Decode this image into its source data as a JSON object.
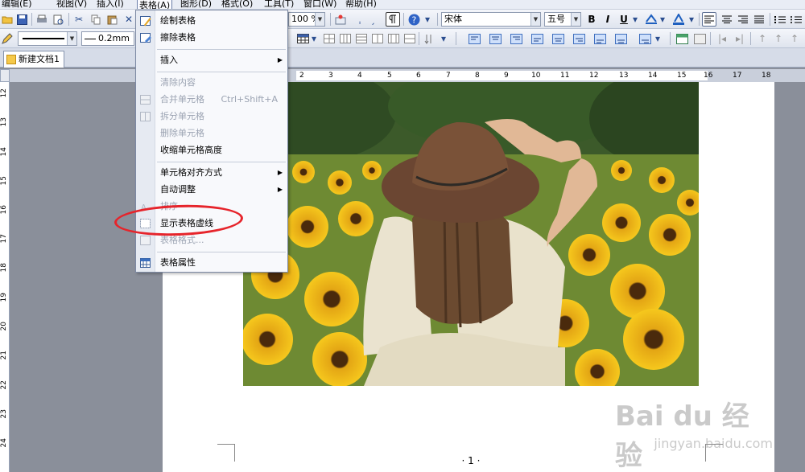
{
  "menubar": {
    "items": [
      "编辑(E)",
      "视图(V)",
      "插入(I)",
      "表格(A)",
      "图形(D)",
      "格式(O)",
      "工具(T)",
      "窗口(W)",
      "帮助(H)"
    ]
  },
  "toolbar1": {
    "zoom": "100 %",
    "font_name": "宋体",
    "font_size": "五号",
    "bold_label": "B",
    "italic_label": "I",
    "underline_label": "U"
  },
  "toolbar2": {
    "line_width": "0.2mm"
  },
  "document_tab": {
    "label": "新建文档1"
  },
  "ruler": {
    "h_ticks": [
      "2",
      "3",
      "4",
      "5",
      "6",
      "7",
      "8",
      "9",
      "10",
      "11",
      "12",
      "13",
      "14",
      "15",
      "16",
      "17",
      "18"
    ],
    "v_ticks": [
      "12",
      "13",
      "14",
      "15",
      "16",
      "17",
      "18",
      "19",
      "20",
      "21",
      "22",
      "23",
      "24"
    ]
  },
  "table_menu": {
    "items": [
      {
        "label": "绘制表格",
        "enabled": true
      },
      {
        "label": "擦除表格",
        "enabled": true
      },
      {
        "label": "插入",
        "enabled": true,
        "submenu": true
      },
      {
        "label": "清除内容",
        "enabled": false
      },
      {
        "label": "合并单元格",
        "enabled": false,
        "shortcut": "Ctrl+Shift+A"
      },
      {
        "label": "拆分单元格",
        "enabled": false
      },
      {
        "label": "删除单元格",
        "enabled": false
      },
      {
        "label": "收缩单元格高度",
        "enabled": true
      },
      {
        "label": "单元格对齐方式",
        "enabled": true,
        "submenu": true
      },
      {
        "label": "自动调整",
        "enabled": true,
        "submenu": true
      },
      {
        "label": "排序",
        "enabled": false
      },
      {
        "label": "显示表格虚线",
        "enabled": true
      },
      {
        "label": "表格格式...",
        "enabled": false
      },
      {
        "label": "表格属性",
        "enabled": true
      }
    ]
  },
  "page": {
    "page_number": "· 1 ·"
  },
  "watermark": {
    "brand": "Bai du 经验",
    "url": "jingyan.baidu.com"
  },
  "colors": {
    "menu_highlight_border": "#6b7fa8",
    "annotation_red": "#e6242b"
  }
}
